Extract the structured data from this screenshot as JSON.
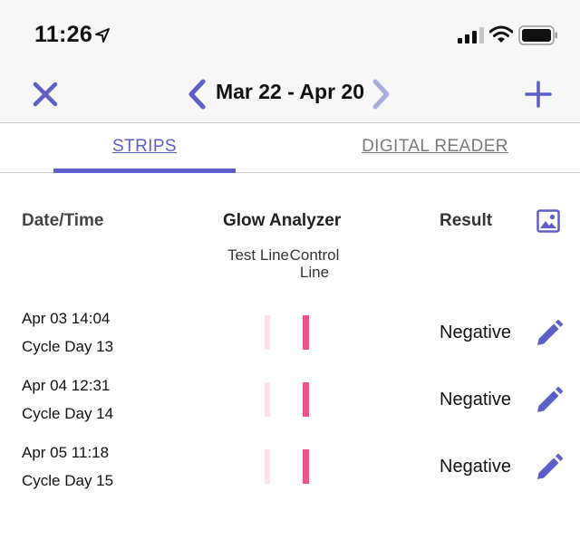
{
  "status_bar": {
    "time": "11:26",
    "icons": [
      "location-arrow-icon",
      "signal-bars-icon",
      "wifi-icon",
      "battery-icon"
    ]
  },
  "nav": {
    "date_range": "Mar 22 - Apr 20",
    "icons": [
      "close-icon",
      "chevron-left-icon",
      "chevron-right-icon",
      "plus-icon"
    ]
  },
  "tabs": [
    {
      "label": "STRIPS",
      "active": true
    },
    {
      "label": "DIGITAL READER",
      "active": false
    }
  ],
  "table": {
    "col_datetime": "Date/Time",
    "col_analyzer": "Glow Analyzer",
    "col_result": "Result",
    "sub_test": "Test Line",
    "sub_control": "Control Line",
    "rows": [
      {
        "date": "Apr 03 14:04",
        "cycle": "Cycle Day 13",
        "result": "Negative"
      },
      {
        "date": "Apr 04 12:31",
        "cycle": "Cycle Day 14",
        "result": "Negative"
      },
      {
        "date": "Apr 05 11:18",
        "cycle": "Cycle Day 15",
        "result": "Negative"
      }
    ]
  },
  "colors": {
    "accent": "#5b5fc7",
    "control_line": "#ec5489",
    "test_line": "#fbe3ea"
  }
}
